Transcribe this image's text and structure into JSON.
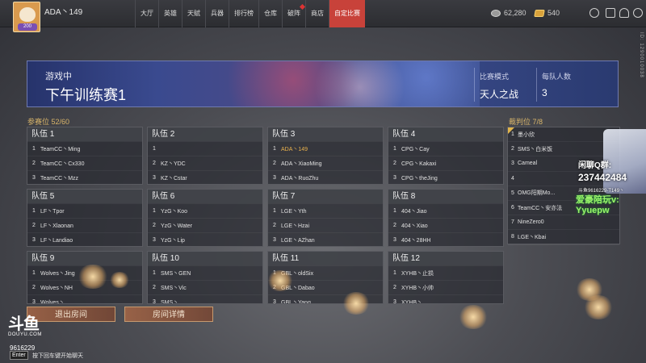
{
  "profile": {
    "name": "ADA丶149",
    "level": "200"
  },
  "nav": [
    {
      "label": "大厅"
    },
    {
      "label": "英雄"
    },
    {
      "label": "天赋"
    },
    {
      "label": "兵器"
    },
    {
      "label": "排行榜"
    },
    {
      "label": "仓库"
    },
    {
      "label": "破阵",
      "dot": true
    },
    {
      "label": "商店"
    },
    {
      "label": "自定比赛",
      "active": true
    }
  ],
  "currency": {
    "silver": "62,280",
    "gold": "540"
  },
  "side_text": "ID: 1290010038",
  "match": {
    "status": "游戏中",
    "title": "下午训练赛1",
    "mode_label": "比赛模式",
    "mode_value": "天人之战",
    "size_label": "每队人数",
    "size_value": "3"
  },
  "participants_label": "参赛位 52/60",
  "referees_label": "裁判位 7/8",
  "teams": [
    {
      "name": "队伍 1",
      "players": [
        {
          "n": "1",
          "name": "TeamCC丶Ming"
        },
        {
          "n": "2",
          "name": "TeamCC丶Cx330"
        },
        {
          "n": "3",
          "name": "TeamCC丶Mzz"
        }
      ]
    },
    {
      "name": "队伍 2",
      "players": [
        {
          "n": "1",
          "name": ""
        },
        {
          "n": "2",
          "name": "KZ丶YDC"
        },
        {
          "n": "3",
          "name": "KZ丶Cstar"
        }
      ]
    },
    {
      "name": "队伍 3",
      "players": [
        {
          "n": "1",
          "name": "ADA丶149",
          "me": true
        },
        {
          "n": "2",
          "name": "ADA丶XiaoMing"
        },
        {
          "n": "3",
          "name": "ADA丶RuoZhu"
        }
      ]
    },
    {
      "name": "队伍 4",
      "players": [
        {
          "n": "1",
          "name": "CPG丶Cay"
        },
        {
          "n": "2",
          "name": "CPG丶Kakaxi"
        },
        {
          "n": "3",
          "name": "CPG丶theJing"
        }
      ]
    },
    {
      "name": "队伍 5",
      "players": [
        {
          "n": "1",
          "name": "LF丶Tpor"
        },
        {
          "n": "2",
          "name": "LF丶Xlaonan"
        },
        {
          "n": "3",
          "name": "LF丶Landiao"
        }
      ]
    },
    {
      "name": "队伍 6",
      "players": [
        {
          "n": "1",
          "name": "YzG丶Koo"
        },
        {
          "n": "2",
          "name": "YzG丶Water"
        },
        {
          "n": "3",
          "name": "YzG丶Lip"
        }
      ]
    },
    {
      "name": "队伍 7",
      "players": [
        {
          "n": "1",
          "name": "LGE丶Yth"
        },
        {
          "n": "2",
          "name": "LGE丶Hzai"
        },
        {
          "n": "3",
          "name": "LGE丶AZhan"
        }
      ]
    },
    {
      "name": "队伍 8",
      "players": [
        {
          "n": "1",
          "name": "404丶Jiao"
        },
        {
          "n": "2",
          "name": "404丶Xiao"
        },
        {
          "n": "3",
          "name": "404丶28HH"
        }
      ]
    },
    {
      "name": "队伍 9",
      "players": [
        {
          "n": "1",
          "name": "Wolves丶Jing"
        },
        {
          "n": "2",
          "name": "Wolves丶NH"
        },
        {
          "n": "3",
          "name": "Wolves丶..."
        }
      ]
    },
    {
      "name": "队伍 10",
      "players": [
        {
          "n": "1",
          "name": "SMS丶GEN"
        },
        {
          "n": "2",
          "name": "SMS丶Vic"
        },
        {
          "n": "3",
          "name": "SMS丶..."
        }
      ]
    },
    {
      "name": "队伍 11",
      "players": [
        {
          "n": "1",
          "name": "GBL丶oldSix"
        },
        {
          "n": "2",
          "name": "GBL丶Dabao"
        },
        {
          "n": "3",
          "name": "GBL丶Yang"
        }
      ]
    },
    {
      "name": "队伍 12",
      "players": [
        {
          "n": "1",
          "name": "XYHB丶止损"
        },
        {
          "n": "2",
          "name": "XYHB丶小帅"
        },
        {
          "n": "3",
          "name": "XYHB丶..."
        }
      ]
    }
  ],
  "referees": [
    {
      "n": "1",
      "name": "墨小欣"
    },
    {
      "n": "2",
      "name": "SMS丶白米饭"
    },
    {
      "n": "3",
      "name": "Cameal"
    },
    {
      "n": "4",
      "name": ""
    },
    {
      "n": "5",
      "name": "OMG阳期Mo..."
    },
    {
      "n": "6",
      "name": "TeamCC丶安亦法"
    },
    {
      "n": "7",
      "name": "NineZero0"
    },
    {
      "n": "8",
      "name": "LGE丶Kbai"
    }
  ],
  "overlay": {
    "qq": "闲聊Q群:",
    "qq_number": "237442484",
    "room": "斗鱼9616229-T149丶",
    "line": "爱豪陪玩v: Yyuepw"
  },
  "buttons": {
    "exit": "退出房间",
    "detail": "房间详情"
  },
  "footer": {
    "logo": "斗鱼",
    "logo_sub": "DOUYU.COM",
    "room_id": "9616229",
    "enter_key": "Enter",
    "chat_hint": "按下回车键开始聊天"
  },
  "colors": {
    "accent": "#c8423a",
    "gold_text": "#e8b14c",
    "section_label": "#d9b56a",
    "banner": "#3a4a8f"
  }
}
